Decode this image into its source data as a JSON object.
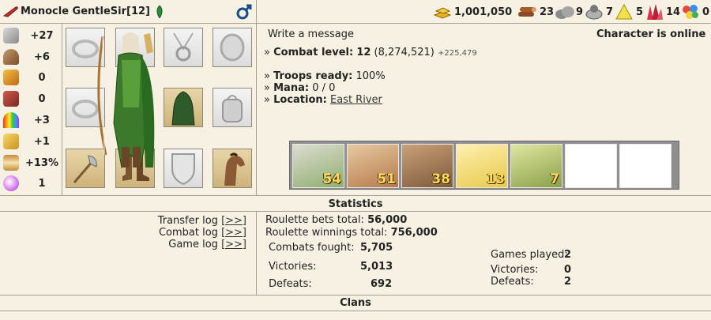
{
  "header": {
    "name": "Monocle GentleSir",
    "level": "[12]",
    "resources": [
      {
        "icon": "gold-icon",
        "value": "1,001,050"
      },
      {
        "icon": "wood-icon",
        "value": "23"
      },
      {
        "icon": "stone-icon",
        "value": "9"
      },
      {
        "icon": "ore-icon",
        "value": "7"
      },
      {
        "icon": "sulfur-icon",
        "value": "5"
      },
      {
        "icon": "crystal-icon",
        "value": "14"
      },
      {
        "icon": "gem-icon",
        "value": "0"
      }
    ]
  },
  "stats": [
    {
      "icon": "attack-icon",
      "value": "+27"
    },
    {
      "icon": "defense-icon",
      "value": "+6"
    },
    {
      "icon": "spell-power-icon",
      "value": "0"
    },
    {
      "icon": "knowledge-icon",
      "value": "0"
    },
    {
      "icon": "luck-icon",
      "value": "+3"
    },
    {
      "icon": "morale-icon",
      "value": "+1"
    },
    {
      "icon": "initiative-icon",
      "value": "+13%"
    },
    {
      "icon": "mana-orb-icon",
      "value": "1"
    }
  ],
  "info": {
    "write_message": "Write a message",
    "online_status": "Character is online",
    "combat_level_label": "Combat level:",
    "combat_level_value": "12",
    "combat_level_exp": "(8,274,521)",
    "combat_level_next": "+225,479",
    "troops_ready_label": "Troops ready:",
    "troops_ready_value": "100%",
    "mana_label": "Mana:",
    "mana_value": "0 / 0",
    "location_label": "Location:",
    "location_value": "East River"
  },
  "troops": [
    {
      "icon": "elf-troop-icon",
      "count": "54",
      "color": "#8fae6e"
    },
    {
      "icon": "dryad-troop-icon",
      "count": "51",
      "color": "#b47a4c"
    },
    {
      "icon": "druid-troop-icon",
      "count": "38",
      "color": "#7d5a3a"
    },
    {
      "icon": "unicorn-troop-icon",
      "count": "13",
      "color": "#e6c94a"
    },
    {
      "icon": "treant-troop-icon",
      "count": "7",
      "color": "#8aa04a"
    }
  ],
  "statistics": {
    "title": "Statistics",
    "logs": [
      {
        "label": "Transfer log",
        "link": "[>>]"
      },
      {
        "label": "Combat log",
        "link": "[>>]"
      },
      {
        "label": "Game log",
        "link": "[>>]"
      }
    ],
    "roulette_bets_label": "Roulette bets total:",
    "roulette_bets_value": "56,000",
    "roulette_win_label": "Roulette winnings total:",
    "roulette_win_value": "756,000",
    "combats_fought_label": "Combats fought:",
    "combats_fought_value": "5,705",
    "victories_label": "Victories:",
    "victories_value": "5,013",
    "defeats_label": "Defeats:",
    "defeats_value": "692",
    "games_played_label": "Games played:",
    "games_played_value": "2",
    "games_victories_label": "Victories:",
    "games_victories_value": "0",
    "games_defeats_label": "Defeats:",
    "games_defeats_value": "2"
  },
  "clans": {
    "title": "Clans"
  },
  "colors": {
    "background": "#f6f1e3",
    "border": "#a9a18e",
    "male_icon": "#1a4d8c",
    "troop_count": "#ffd95a"
  }
}
